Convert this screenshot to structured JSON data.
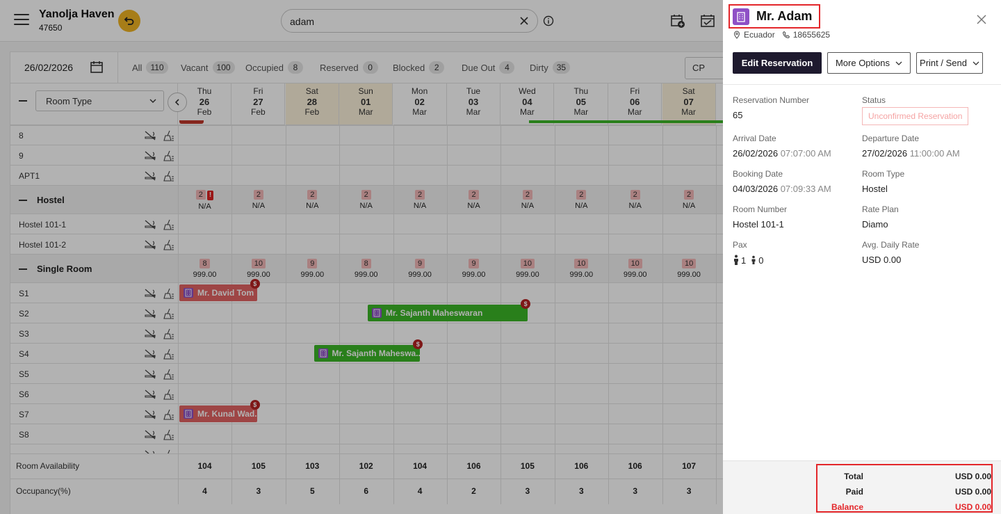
{
  "app": {
    "property_name": "Yanolja Haven",
    "property_id": "47650"
  },
  "search": {
    "value": "adam",
    "placeholder": ""
  },
  "filters": {
    "date": "26/02/2026",
    "chips": [
      {
        "label": "All",
        "count": "110"
      },
      {
        "label": "Vacant",
        "count": "100"
      },
      {
        "label": "Occupied",
        "count": "8"
      },
      {
        "label": "Reserved",
        "count": "0"
      },
      {
        "label": "Blocked",
        "count": "2"
      },
      {
        "label": "Due Out",
        "count": "4"
      },
      {
        "label": "Dirty",
        "count": "35"
      }
    ],
    "rate_select": "CP"
  },
  "grid": {
    "room_type_select": "Room Type",
    "dates": [
      {
        "dow": "Thu",
        "day": "26",
        "mon": "Feb",
        "weekend": false
      },
      {
        "dow": "Fri",
        "day": "27",
        "mon": "Feb",
        "weekend": false
      },
      {
        "dow": "Sat",
        "day": "28",
        "mon": "Feb",
        "weekend": true
      },
      {
        "dow": "Sun",
        "day": "01",
        "mon": "Mar",
        "weekend": true
      },
      {
        "dow": "Mon",
        "day": "02",
        "mon": "Mar",
        "weekend": false
      },
      {
        "dow": "Tue",
        "day": "03",
        "mon": "Mar",
        "weekend": false
      },
      {
        "dow": "Wed",
        "day": "04",
        "mon": "Mar",
        "weekend": false
      },
      {
        "dow": "Thu",
        "day": "05",
        "mon": "Mar",
        "weekend": false
      },
      {
        "dow": "Fri",
        "day": "06",
        "mon": "Mar",
        "weekend": false
      },
      {
        "dow": "Sat",
        "day": "07",
        "mon": "Mar",
        "weekend": true
      }
    ],
    "rooms_top": [
      "8",
      "9",
      "APT1"
    ],
    "hostel": {
      "name": "Hostel",
      "counts": [
        "2",
        "2",
        "2",
        "2",
        "2",
        "2",
        "2",
        "2",
        "2",
        "2"
      ],
      "alert": "!",
      "rate": "N/A",
      "rooms": [
        "Hostel 101-1",
        "Hostel 101-2"
      ]
    },
    "single": {
      "name": "Single Room",
      "counts": [
        "8",
        "10",
        "9",
        "8",
        "9",
        "9",
        "10",
        "10",
        "10",
        "10"
      ],
      "rate": "999.00",
      "rooms": [
        "S1",
        "S2",
        "S3",
        "S4",
        "S5",
        "S6",
        "S7",
        "S8"
      ]
    },
    "reservations": [
      {
        "guest": "Mr. David Tom",
        "color": "red"
      },
      {
        "guest": "Mr. Sajanth Maheswaran",
        "color": "green"
      },
      {
        "guest": "Mr. Sajanth Maheswa...",
        "color": "green"
      },
      {
        "guest": "Mr. Kunal Wad...",
        "color": "red"
      }
    ],
    "dollar_symbol": "$"
  },
  "footer": {
    "availability_label": "Room Availability",
    "availability": [
      "104",
      "105",
      "103",
      "102",
      "104",
      "106",
      "105",
      "106",
      "106",
      "107"
    ],
    "occupancy_label": "Occupancy(%)",
    "occupancy": [
      "4",
      "3",
      "5",
      "6",
      "4",
      "2",
      "3",
      "3",
      "3",
      "3"
    ]
  },
  "panel": {
    "guest_name": "Mr. Adam",
    "country": "Ecuador",
    "phone": "18655625",
    "buttons": {
      "edit": "Edit Reservation",
      "more": "More Options",
      "print": "Print / Send"
    },
    "fields": {
      "reservation_number_label": "Reservation Number",
      "reservation_number": "65",
      "status_label": "Status",
      "status": "Unconfirmed Reservation",
      "arrival_label": "Arrival Date",
      "arrival_date": "26/02/2026",
      "arrival_time": "07:07:00 AM",
      "departure_label": "Departure Date",
      "departure_date": "27/02/2026",
      "departure_time": "11:00:00 AM",
      "booking_label": "Booking Date",
      "booking_date": "04/03/2026",
      "booking_time": "07:09:33 AM",
      "room_type_label": "Room Type",
      "room_type": "Hostel",
      "room_number_label": "Room Number",
      "room_number": "Hostel 101-1",
      "rate_plan_label": "Rate Plan",
      "rate_plan": "Diamo",
      "pax_label": "Pax",
      "pax_adults": "1",
      "pax_children": "0",
      "adr_label": "Avg. Daily Rate",
      "adr": "USD 0.00"
    },
    "totals": {
      "total_label": "Total",
      "total": "USD 0.00",
      "paid_label": "Paid",
      "paid": "USD 0.00",
      "balance_label": "Balance",
      "balance": "USD 0.00"
    }
  },
  "colors": {
    "accent_red": "#e3262a",
    "primary_dark": "#1e1a2e",
    "reservation_red": "#e26464",
    "reservation_green": "#3cb628",
    "brand_yellow": "#f0b323",
    "guest_icon_purple": "#8e50c6"
  },
  "icons": [
    "hamburger-icon",
    "undo-icon",
    "clear-icon",
    "info-icon",
    "calendar-add-icon",
    "calendar-check-icon",
    "calendar-icon",
    "chevron-down-icon",
    "chevron-left-icon",
    "no-smoking-icon",
    "cleaning-icon",
    "building-icon",
    "location-icon",
    "phone-icon",
    "close-icon",
    "adult-icon",
    "child-icon"
  ]
}
